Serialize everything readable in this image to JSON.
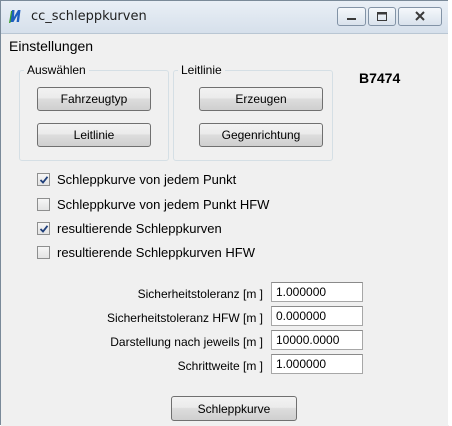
{
  "window": {
    "title": "cc_schleppkurven",
    "icon": "mu-app-icon"
  },
  "menu": {
    "items": [
      {
        "label": "Einstellungen"
      }
    ]
  },
  "auswaehlen": {
    "label": "Auswählen",
    "fahrzeugtyp_button": "Fahrzeugtyp",
    "leitlinie_button": "Leitlinie"
  },
  "leitlinie_group": {
    "label": "Leitlinie",
    "erzeugen_button": "Erzeugen",
    "gegenrichtung_button": "Gegenrichtung"
  },
  "vehicle_code": "B7474",
  "checkboxes": [
    {
      "label": "Schleppkurve von jedem Punkt",
      "checked": true
    },
    {
      "label": "Schleppkurve von jedem Punkt HFW",
      "checked": false
    },
    {
      "label": "resultierende Schleppkurven",
      "checked": true
    },
    {
      "label": "resultierende Schleppkurven HFW",
      "checked": false
    }
  ],
  "fields": [
    {
      "label": "Sicherheitstoleranz [m ]",
      "value": "1.000000"
    },
    {
      "label": "Sicherheitstoleranz HFW [m ]",
      "value": "0.000000"
    },
    {
      "label": "Darstellung nach jeweils [m ]",
      "value": "10000.0000"
    },
    {
      "label": "Schrittweite [m ]",
      "value": "1.000000"
    }
  ],
  "action": {
    "schleppkurve_button": "Schleppkurve"
  },
  "colors": {
    "accent_check": "#1f3f7a",
    "icon_green": "#3aa12c",
    "icon_blue": "#1f5fbf"
  }
}
